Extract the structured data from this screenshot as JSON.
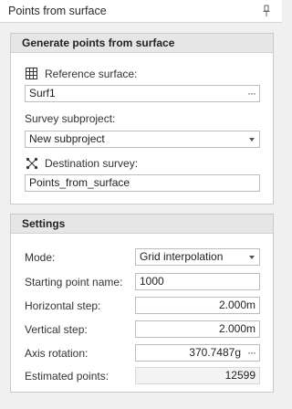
{
  "panel": {
    "title": "Points from surface",
    "pin_icon": "pin-icon"
  },
  "generate": {
    "title": "Generate points from surface",
    "reference_surface": {
      "label": "Reference surface:",
      "icon": "grid-icon",
      "value": "Surf1",
      "browse": "···"
    },
    "survey_subproject": {
      "label": "Survey subproject:",
      "value": "New subproject"
    },
    "destination_survey": {
      "label": "Destination survey:",
      "icon": "survey-points-icon",
      "value": "Points_from_surface"
    }
  },
  "settings": {
    "title": "Settings",
    "mode": {
      "label": "Mode:",
      "value": "Grid interpolation"
    },
    "starting_point_name": {
      "label": "Starting point name:",
      "value": "1000"
    },
    "horizontal_step": {
      "label": "Horizontal step:",
      "value": "2.000m"
    },
    "vertical_step": {
      "label": "Vertical step:",
      "value": "2.000m"
    },
    "axis_rotation": {
      "label": "Axis rotation:",
      "value": "370.7487g",
      "browse": "···"
    },
    "estimated_points": {
      "label": "Estimated points:",
      "value": "12599"
    }
  },
  "colors": {
    "group_header_bg": "#e6e6e6",
    "panel_bg": "#f0f0f0",
    "field_border": "#bdbdbd"
  }
}
